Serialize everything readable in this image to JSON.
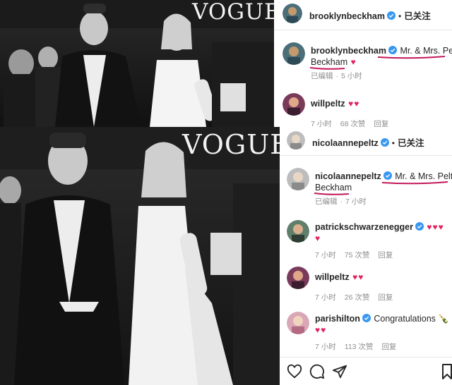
{
  "posts": [
    {
      "magazine_logo": "VOGUE",
      "header": {
        "username": "brooklynbeckham",
        "follow_label": "已关注"
      },
      "caption": {
        "username": "brooklynbeckham",
        "text": "Mr. & Mrs. Peltz Beckham",
        "text_line1": "Mr. & Mrs. Peltz",
        "text_line2": "Beckham",
        "emoji": "♥"
      },
      "caption_meta": {
        "edited": "已编辑",
        "time": "5 小时"
      },
      "comments": [
        {
          "username": "willpeltz",
          "text": "♥♥",
          "time": "7 小时",
          "likes": "68 次赞",
          "reply": "回复"
        }
      ]
    },
    {
      "magazine_logo": "VOGUE",
      "header": {
        "username": "nicolaannepeltz",
        "follow_label": "已关注"
      },
      "caption": {
        "username": "nicolaannepeltz",
        "text": "Mr. & Mrs. Peltz Beckham",
        "text_line1": "Mr. & Mrs. Peltz",
        "text_line2": "Beckham"
      },
      "caption_meta": {
        "edited": "已编辑",
        "time": "7 小时"
      },
      "comments": [
        {
          "username": "patrickschwarzenegger",
          "text": "♥♥♥",
          "text_line2": "♥",
          "time": "7 小时",
          "likes": "75 次赞",
          "reply": "回复"
        },
        {
          "username": "willpeltz",
          "text": "♥♥",
          "time": "7 小时",
          "likes": "26 次赞",
          "reply": "回复"
        },
        {
          "username": "parishilton",
          "text": "Congratulations 🍾",
          "text_line2": "♥♥",
          "time": "7 小时",
          "likes": "113 次赞",
          "reply": "回复"
        }
      ]
    }
  ],
  "colors": {
    "verified": "#3897f0",
    "heart": "#e0245e",
    "underline": "#c2185b",
    "meta": "#8e8e8e"
  },
  "icons": [
    "heart-icon",
    "comment-icon",
    "share-icon",
    "bookmark-icon",
    "verified-badge-icon"
  ]
}
